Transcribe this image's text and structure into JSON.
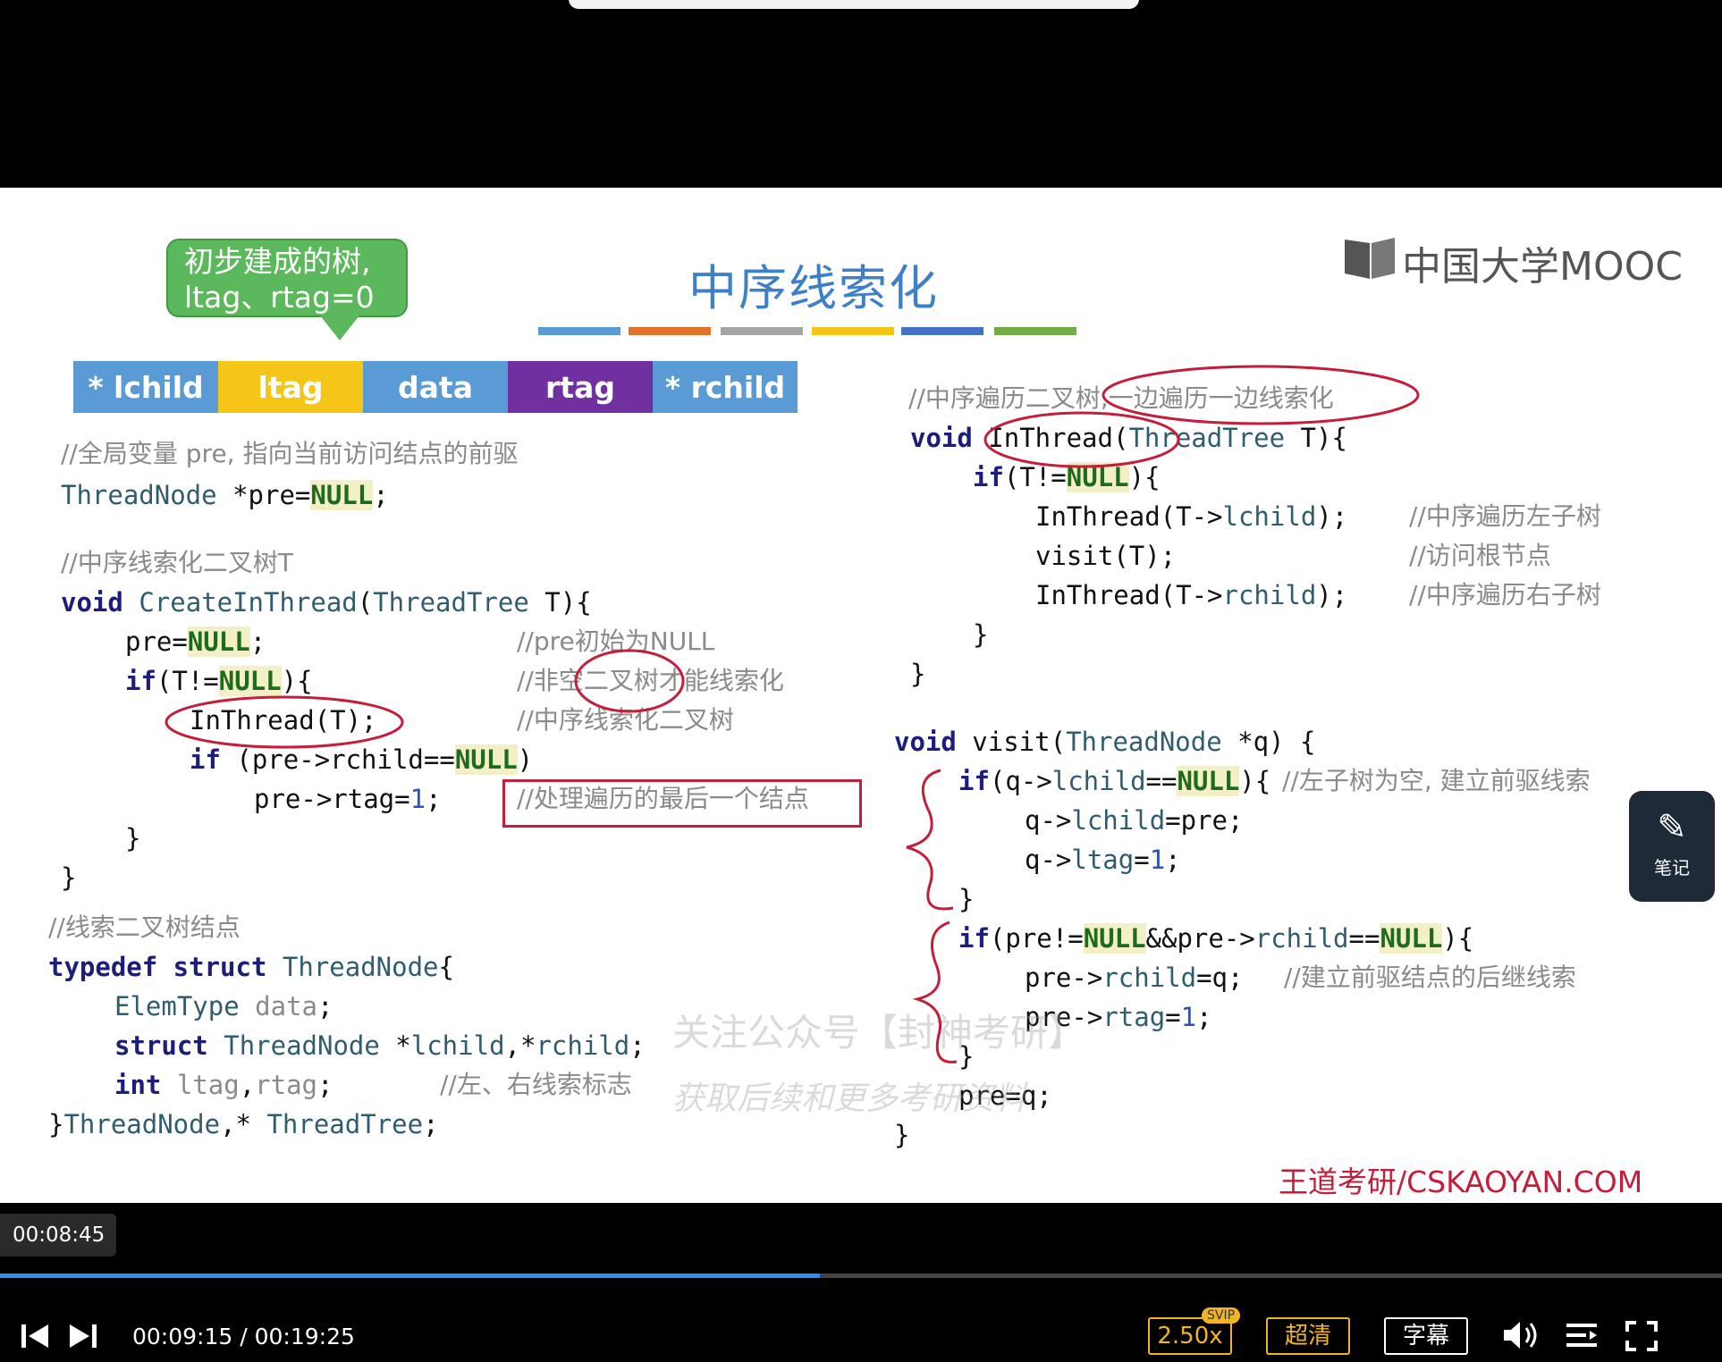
{
  "player": {
    "tooltip_time": "00:08:45",
    "current_time": "00:09:15",
    "separator": " / ",
    "total_time": "00:19:25",
    "progress": 0.476,
    "speed_label": "2.50x",
    "svip_badge": "SVIP",
    "quality_label": "超清",
    "subtitle_label": "字幕"
  },
  "slide": {
    "bubble": [
      "初步建成的树,",
      "ltag、rtag=0"
    ],
    "title": "中序线索化",
    "title_bar_colors": [
      "#5b9bd5",
      "#e0722c",
      "#a5a5a5",
      "#f5c518",
      "#4472c4",
      "#70ad47"
    ],
    "logo": "中国大学MOOC",
    "fields": [
      {
        "label": "* lchild",
        "color": "#5b9bd5"
      },
      {
        "label": "ltag",
        "color": "#f5c518"
      },
      {
        "label": "data",
        "color": "#5b9bd5"
      },
      {
        "label": "rtag",
        "color": "#7030a0"
      },
      {
        "label": "* rchild",
        "color": "#5b9bd5"
      }
    ],
    "comment_global": "//全局变量 pre, 指向当前访问结点的前驱",
    "comment_create": "//中序线索化二叉树T",
    "comment_pre_null": "//pre初始为NULL",
    "comment_nonempty": "//非空二叉树才能线索化",
    "comment_inthread": "//中序线索化二叉树",
    "comment_last": "//处理遍历的最后一个结点",
    "comment_struct": "//线索二叉树结点",
    "comment_tags": "//左、右线索标志",
    "comment_inorder": "//中序遍历二叉树,一边遍历一边线索化",
    "comment_left": "//中序遍历左子树",
    "comment_visit": "//访问根节点",
    "comment_right": "//中序遍历右子树",
    "comment_pred": "//左子树为空, 建立前驱线索",
    "comment_succ": "//建立前驱结点的后继线索",
    "watermark_1": "关注公众号【封神考研】",
    "watermark_2": "获取后续和更多考研资料",
    "footer": "王道考研/CSKAOYAN.COM",
    "note_label": "笔记"
  },
  "icons": [
    "prev-icon",
    "next-icon",
    "volume-icon",
    "playlist-icon",
    "fullscreen-icon",
    "note-icon"
  ]
}
